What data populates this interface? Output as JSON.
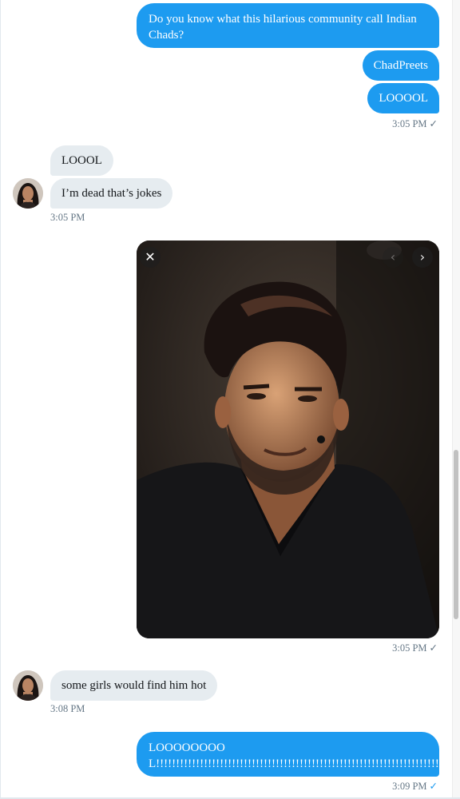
{
  "messages": {
    "out1": "Do you know what this hilarious community call Indian Chads?",
    "out2": "ChadPreets",
    "out3": "LOOOOL",
    "ts1": "3:05 PM",
    "in1": "LOOOL",
    "in2": "I’m dead that’s jokes",
    "ts2": "3:05 PM",
    "ts3": "3:05 PM",
    "in3": "some girls would find him hot",
    "ts4": "3:08 PM",
    "out4": "LOOOOOOOOL!!!!!!!!!!!!!!!!!!!!!!!!!!!!!!!!!!!!!!!!!!!!!!!!!!!!!!!!!!!!!!!!!!!!!!!!!!!!!!!!!!",
    "ts5": "3:09 PM"
  },
  "icons": {
    "sent": "checkmark-icon",
    "close": "close-icon",
    "prev": "chevron-left-icon",
    "next": "chevron-right-icon"
  },
  "colors": {
    "outgoing_bubble": "#1d9bf0",
    "incoming_bubble": "#e6ecf0",
    "timestamp": "#657786"
  }
}
